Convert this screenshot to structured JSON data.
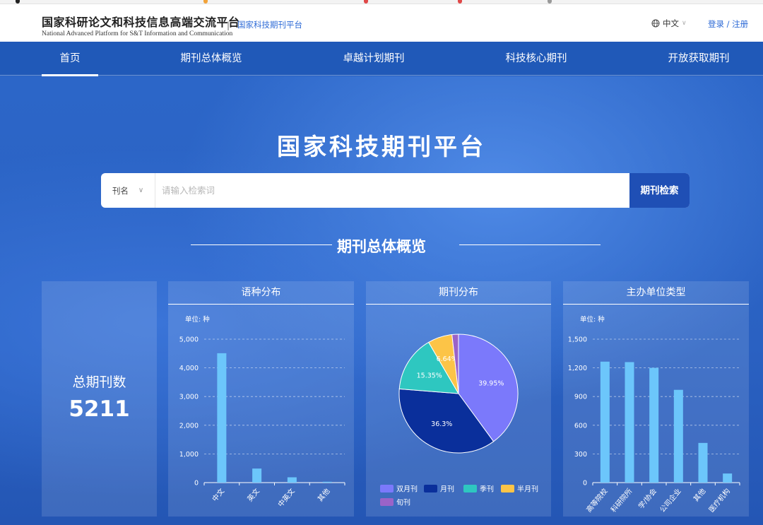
{
  "header": {
    "logo_cn": "国家科研论文和科技信息高端交流平台",
    "logo_en": "National Advanced Platform for S&T Information and Communication",
    "separator": "|",
    "sub_title": "国家科技期刊平台",
    "language": "中文",
    "login": "登录 / 注册",
    "language_icon": "globe-icon"
  },
  "nav": {
    "items": [
      {
        "label": "首页",
        "active": true
      },
      {
        "label": "期刊总体概览",
        "active": false
      },
      {
        "label": "卓越计划期刊",
        "active": false
      },
      {
        "label": "科技核心期刊",
        "active": false
      },
      {
        "label": "开放获取期刊",
        "active": false
      }
    ]
  },
  "hero": {
    "title": "国家科技期刊平台",
    "search": {
      "field_label": "刊名",
      "placeholder": "请输入检索词",
      "value": "",
      "button_label": "期刊检索"
    }
  },
  "overview": {
    "title": "期刊总体概览",
    "total": {
      "label": "总期刊数",
      "value": "5211"
    },
    "panels": {
      "language": {
        "title": "语种分布",
        "unit": "单位: 种"
      },
      "frequency": {
        "title": "期刊分布"
      },
      "sponsor": {
        "title": "主办单位类型",
        "unit": "单位: 种"
      }
    }
  },
  "colors": {
    "header_bg": "#ffffff",
    "nav_bg": "#2059b8",
    "hero_bg": "#2a63c4",
    "accent_link": "#2d6ad6",
    "search_button": "#1f4fb5",
    "bar": "#6cc6fb"
  },
  "chart_data": [
    {
      "type": "bar",
      "categories": [
        "中文",
        "英文",
        "中英文",
        "其他"
      ],
      "values": [
        4510,
        490,
        185,
        30
      ],
      "ylim": [
        0,
        5000
      ],
      "yticks": [
        "0",
        "1,000",
        "2,000",
        "3,000",
        "4,000",
        "5,000"
      ],
      "grid": true
    },
    {
      "type": "pie",
      "labels": [
        "双月刊",
        "月刊",
        "季刊",
        "半月刊",
        "旬刊"
      ],
      "values": [
        39.95,
        36.3,
        15.35,
        6.64,
        1.76
      ],
      "data_labels": [
        "39.95%",
        "36.3%",
        "15.35%",
        "6.64%",
        ""
      ],
      "colors": [
        "#7b79fb",
        "#0a2f9b",
        "#2ec7c0",
        "#fcc447",
        "#9a63c8"
      ],
      "legend": "bottom"
    },
    {
      "type": "bar",
      "categories": [
        "高等院校",
        "科研院所",
        "学/协会",
        "公司企业",
        "其他",
        "医疗机构"
      ],
      "values": [
        1265,
        1260,
        1200,
        970,
        415,
        95
      ],
      "ylim": [
        0,
        1500
      ],
      "yticks": [
        "0",
        "300",
        "600",
        "900",
        "1,200",
        "1,500"
      ],
      "grid": true
    }
  ]
}
